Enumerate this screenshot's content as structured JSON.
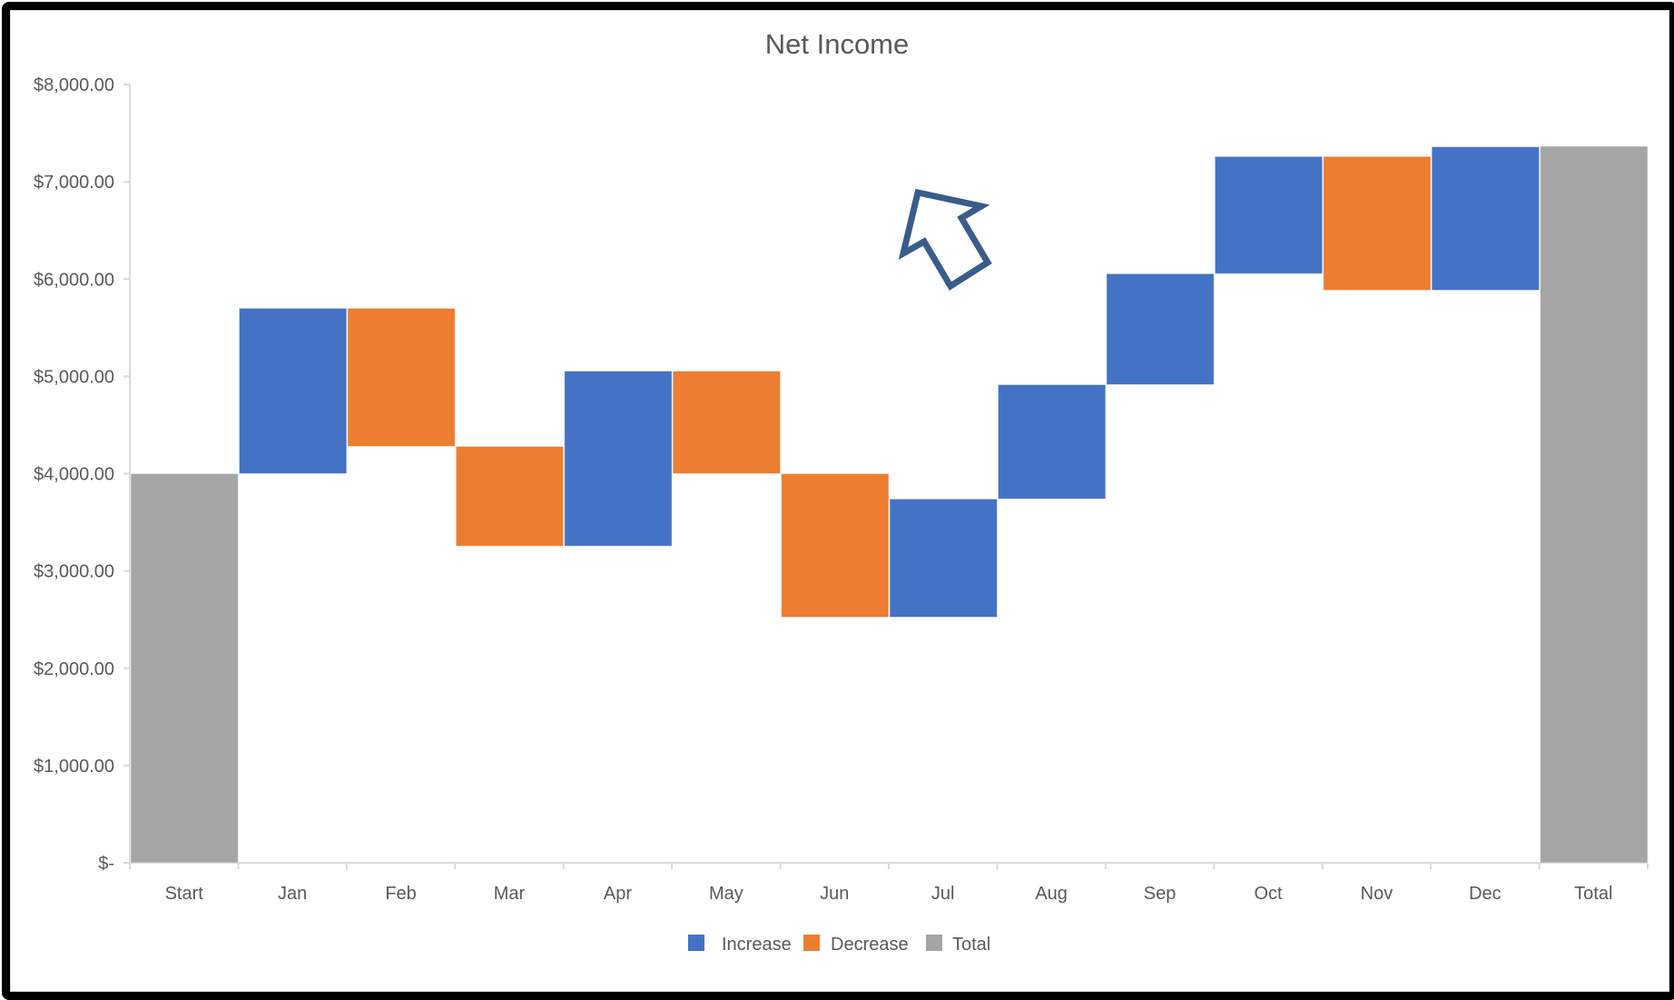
{
  "chart_data": {
    "type": "bar",
    "subtype": "waterfall",
    "title": "Net Income",
    "xlabel": "",
    "ylabel": "",
    "ylim": [
      0,
      8000
    ],
    "grid": false,
    "legend_position": "bottom",
    "categories": [
      "Start",
      "Jan",
      "Feb",
      "Mar",
      "Apr",
      "May",
      "Jun",
      "Jul",
      "Aug",
      "Sep",
      "Oct",
      "Nov",
      "Dec",
      "Total"
    ],
    "values": [
      4000,
      1700,
      -1420,
      -1025,
      1800,
      -1055,
      -1475,
      1215,
      1175,
      1140,
      1205,
      -1375,
      1475,
      7365
    ],
    "kinds": [
      "total",
      "increase",
      "decrease",
      "decrease",
      "increase",
      "decrease",
      "decrease",
      "increase",
      "increase",
      "increase",
      "increase",
      "decrease",
      "increase",
      "total"
    ],
    "y_ticks": [
      0,
      1000,
      2000,
      3000,
      4000,
      5000,
      6000,
      7000,
      8000
    ],
    "y_tick_labels": [
      "$-",
      "$1,000.00",
      "$2,000.00",
      "$3,000.00",
      "$4,000.00",
      "$5,000.00",
      "$6,000.00",
      "$7,000.00",
      "$8,000.00"
    ],
    "legend": [
      {
        "key": "increase",
        "label": "Increase",
        "color": "#4472C4"
      },
      {
        "key": "decrease",
        "label": "Decrease",
        "color": "#ED7D31"
      },
      {
        "key": "total",
        "label": "Total",
        "color": "#A5A5A5"
      }
    ]
  },
  "annotation": {
    "icon": "arrow-up-left-outline-icon",
    "color": "#385D8A"
  }
}
